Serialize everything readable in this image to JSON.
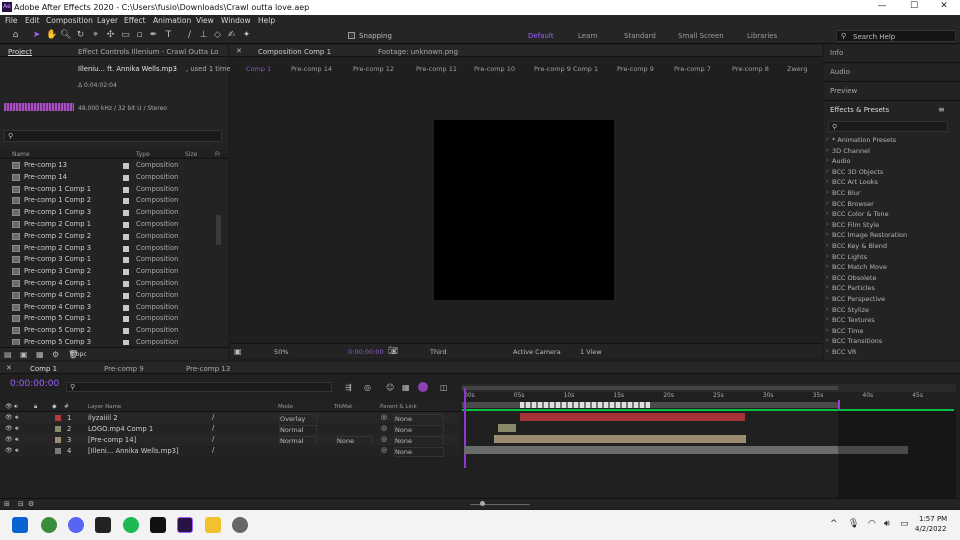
{
  "window": {
    "title": "Adobe After Effects 2020 - C:\\Users\\fusio\\Downloads\\Crawl outta love.aep",
    "logo": "Ae",
    "min": "—",
    "max": "☐",
    "close": "✕"
  },
  "menu": [
    "File",
    "Edit",
    "Composition",
    "Layer",
    "Effect",
    "Animation",
    "View",
    "Window",
    "Help"
  ],
  "toolbar": {
    "snapping": "Snapping",
    "workspaces": [
      "Default",
      "Learn",
      "Standard",
      "Small Screen",
      "Libraries"
    ],
    "search_placeholder": "Search Help"
  },
  "project": {
    "tab_label": "Project",
    "effect_tab": "Effect Controls Illenium - Crawl Outta Lo",
    "selected_name": "Illeniu... ft. Annika Wells.mp3",
    "selected_used": ", used 1 time",
    "duration": "Δ 0:04:02:04",
    "audio_info": "48.000 kHz / 32 bit U / Stereo",
    "columns": {
      "name": "Name",
      "type": "Type",
      "size": "Size",
      "fr": "Fr"
    },
    "items": [
      {
        "name": "Pre-comp 13",
        "type": "Composition"
      },
      {
        "name": "Pre-comp 14",
        "type": "Composition"
      },
      {
        "name": "Pre-comp 1 Comp 1",
        "type": "Composition"
      },
      {
        "name": "Pre-comp 1 Comp 2",
        "type": "Composition"
      },
      {
        "name": "Pre-comp 1 Comp 3",
        "type": "Composition"
      },
      {
        "name": "Pre-comp 2 Comp 1",
        "type": "Composition"
      },
      {
        "name": "Pre-comp 2 Comp 2",
        "type": "Composition"
      },
      {
        "name": "Pre-comp 2 Comp 3",
        "type": "Composition"
      },
      {
        "name": "Pre-comp 3 Comp 1",
        "type": "Composition"
      },
      {
        "name": "Pre-comp 3 Comp 2",
        "type": "Composition"
      },
      {
        "name": "Pre-comp 4 Comp 1",
        "type": "Composition"
      },
      {
        "name": "Pre-comp 4 Comp 2",
        "type": "Composition"
      },
      {
        "name": "Pre-comp 4 Comp 3",
        "type": "Composition"
      },
      {
        "name": "Pre-comp 5 Comp 1",
        "type": "Composition"
      },
      {
        "name": "Pre-comp 5 Comp 2",
        "type": "Composition"
      },
      {
        "name": "Pre-comp 5 Comp 3",
        "type": "Composition"
      }
    ],
    "bpc": "8 bpc"
  },
  "composition": {
    "tab_label": "Composition Comp 1",
    "footage_tab": "Footage: unknown.png",
    "sub_tabs": [
      "Comp 1",
      "Pre-comp 14",
      "Pre-comp 12",
      "Pre-comp 11",
      "Pre-comp 10",
      "Pre-comp 9 Comp 1",
      "Pre-comp 9",
      "Pre-comp 7",
      "Pre-comp 8",
      "Zwerg"
    ],
    "zoom": "50%",
    "timecode": "0:00:00:00",
    "resolution": "Third",
    "camera": "Active Camera",
    "views": "1 View"
  },
  "right": {
    "panels": [
      "Info",
      "Audio",
      "Preview",
      "Effects & Presets"
    ],
    "fx": [
      "* Animation Presets",
      "3D Channel",
      "Audio",
      "BCC 3D Objects",
      "BCC Art Looks",
      "BCC Blur",
      "BCC Browser",
      "BCC Color & Tone",
      "BCC Film Style",
      "BCC Image Restoration",
      "BCC Key & Blend",
      "BCC Lights",
      "BCC Match Move",
      "BCC Obsolete",
      "BCC Particles",
      "BCC Perspective",
      "BCC Stylize",
      "BCC Textures",
      "BCC Time",
      "BCC Transitions",
      "BCC VR"
    ]
  },
  "timeline": {
    "tabs": [
      "Comp 1",
      "Pre-comp 9",
      "Pre-comp 13"
    ],
    "timecode": "0:00:00:00",
    "headers": {
      "layer_name": "Layer Name",
      "mode": "Mode",
      "trkmat": "TrkMat",
      "parent": "Parent & Link"
    },
    "ruler": [
      "00s",
      "05s",
      "10s",
      "15s",
      "20s",
      "25s",
      "30s",
      "35s",
      "40s",
      "45s"
    ],
    "layers": [
      {
        "num": "1",
        "name": "ilyzaiiil 2",
        "mode": "Overlay",
        "trk": "",
        "parent": "None",
        "color": "#b8373a"
      },
      {
        "num": "2",
        "name": "LOGO.mp4 Comp 1",
        "mode": "Normal",
        "trk": "",
        "parent": "None",
        "color": "#8a8a6a"
      },
      {
        "num": "3",
        "name": "[Pre-comp 14]",
        "mode": "Normal",
        "trk": "None",
        "parent": "None",
        "color": "#9a8c6e"
      },
      {
        "num": "4",
        "name": "[Illeni... Annika Wells.mp3]",
        "mode": "",
        "trk": "",
        "parent": "None",
        "color": "#7a7a7a"
      }
    ]
  },
  "taskbar": {
    "time": "1:57 PM",
    "date": "4/2/2022"
  }
}
